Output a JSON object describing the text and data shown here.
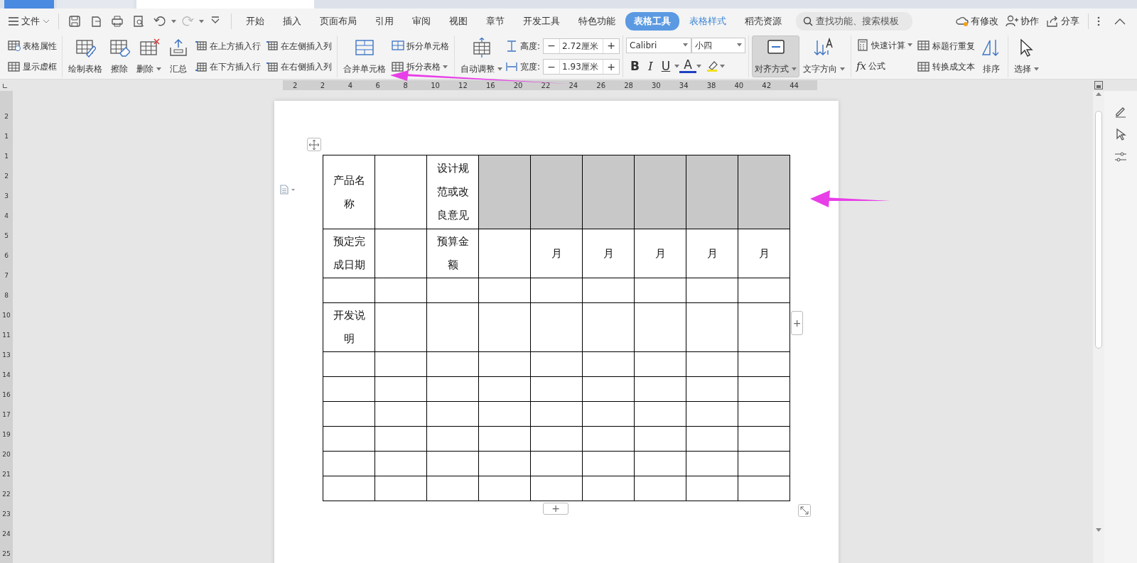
{
  "file_menu": {
    "label": "文件"
  },
  "menu_tabs": [
    {
      "label": "开始",
      "selected": false,
      "kind": "main"
    },
    {
      "label": "插入",
      "selected": false,
      "kind": "main"
    },
    {
      "label": "页面布局",
      "selected": false,
      "kind": "main"
    },
    {
      "label": "引用",
      "selected": false,
      "kind": "main"
    },
    {
      "label": "审阅",
      "selected": false,
      "kind": "main"
    },
    {
      "label": "视图",
      "selected": false,
      "kind": "main"
    },
    {
      "label": "章节",
      "selected": false,
      "kind": "main"
    },
    {
      "label": "开发工具",
      "selected": false,
      "kind": "main"
    },
    {
      "label": "特色功能",
      "selected": false,
      "kind": "main"
    },
    {
      "label": "表格工具",
      "selected": true,
      "kind": "context"
    },
    {
      "label": "表格样式",
      "selected": false,
      "kind": "context"
    },
    {
      "label": "稻壳资源",
      "selected": false,
      "kind": "main"
    }
  ],
  "search": {
    "placeholder": "查找功能、搜索模板"
  },
  "header_actions": [
    "有修改",
    "协作",
    "分享"
  ],
  "ribbon": {
    "groups": [
      {
        "items": [
          {
            "kind": "stack",
            "entries": [
              {
                "label": "表格属性"
              },
              {
                "label": "显示虚框"
              }
            ]
          }
        ]
      },
      {
        "items": [
          {
            "kind": "large",
            "label": "绘制表格",
            "pressed": false
          },
          {
            "kind": "large",
            "label": "擦除",
            "pressed": false
          },
          {
            "kind": "large",
            "label": "删除",
            "pressed": false,
            "dropdown": true
          },
          {
            "kind": "large",
            "label": "汇总",
            "pressed": false
          },
          {
            "kind": "stack",
            "entries": [
              {
                "label": "在上方插入行"
              },
              {
                "label": "在下方插入行"
              }
            ]
          },
          {
            "kind": "stack",
            "entries": [
              {
                "label": "在左侧插入列"
              },
              {
                "label": "在右侧插入列"
              }
            ]
          }
        ]
      },
      {
        "items": [
          {
            "kind": "large",
            "label": "合并单元格",
            "pressed": false
          },
          {
            "kind": "stack",
            "entries": [
              {
                "label": "拆分单元格"
              },
              {
                "label": "拆分表格",
                "dropdown": true
              }
            ]
          }
        ]
      },
      {
        "items": [
          {
            "kind": "large",
            "label": "自动调整",
            "pressed": false,
            "dropdown": true
          },
          {
            "kind": "spinners",
            "entries": [
              {
                "label": "高度:",
                "value": "2.72厘米",
                "decrement": "−",
                "increment": "+"
              },
              {
                "label": "宽度:",
                "value": "1.93厘米",
                "decrement": "−",
                "increment": "+"
              }
            ]
          }
        ]
      },
      {
        "items": [
          {
            "kind": "font",
            "font_name": "Calibri",
            "font_size": "小四",
            "bold": "B",
            "italic": "I",
            "underline": "U",
            "font_color": "A"
          }
        ]
      },
      {
        "items": [
          {
            "kind": "large",
            "label": "对齐方式",
            "pressed": true,
            "dropdown": true
          },
          {
            "kind": "large",
            "label": "文字方向",
            "pressed": false,
            "dropdown": true
          }
        ]
      },
      {
        "items": [
          {
            "kind": "stack",
            "entries": [
              {
                "label": "快速计算",
                "dropdown": true
              },
              {
                "label": "公式",
                "glyph": "fx"
              }
            ]
          },
          {
            "kind": "stack",
            "entries": [
              {
                "label": "标题行重复"
              },
              {
                "label": "转换成文本"
              }
            ]
          },
          {
            "kind": "large",
            "label": "排序",
            "pressed": false
          }
        ]
      },
      {
        "items": [
          {
            "kind": "large",
            "label": "选择",
            "pressed": false,
            "dropdown": true
          }
        ]
      }
    ]
  },
  "ruler": {
    "horizontal": [
      "2",
      "2",
      "4",
      "6",
      "8",
      "10",
      "12",
      "16",
      "20",
      "22",
      "24",
      "26",
      "28",
      "30",
      "34",
      "38",
      "40",
      "42",
      "44"
    ],
    "vertical": [
      "2",
      "1",
      "1",
      "2",
      "3",
      "4",
      "5",
      "6",
      "7",
      "8",
      "10",
      "11",
      "13",
      "14",
      "16",
      "17",
      "19",
      "20",
      "21",
      "22",
      "23",
      "24",
      "25"
    ]
  },
  "table": {
    "rows": [
      [
        {
          "text": "产品名称",
          "shaded": false
        },
        {
          "shaded": false
        },
        {
          "text": "设计规范或改良意见",
          "shaded": false
        },
        {
          "shaded": true
        },
        {
          "shaded": true
        },
        {
          "shaded": true
        },
        {
          "shaded": true
        },
        {
          "shaded": true
        },
        {
          "shaded": true
        }
      ],
      [
        {
          "text": "预定完成日期",
          "shaded": false
        },
        {
          "shaded": false
        },
        {
          "text": "预算金额",
          "shaded": false
        },
        {
          "shaded": false
        },
        {
          "text": "月",
          "shaded": false
        },
        {
          "text": "月",
          "shaded": false
        },
        {
          "text": "月",
          "shaded": false
        },
        {
          "text": "月",
          "shaded": false
        },
        {
          "text": "月",
          "shaded": false
        }
      ],
      [
        {
          "shaded": false
        },
        {
          "shaded": false
        },
        {
          "shaded": false
        },
        {
          "shaded": false
        },
        {
          "shaded": false
        },
        {
          "shaded": false
        },
        {
          "shaded": false
        },
        {
          "shaded": false
        },
        {
          "shaded": false
        }
      ],
      [
        {
          "text": "开发说明",
          "shaded": false
        },
        {
          "shaded": false
        },
        {
          "shaded": false
        },
        {
          "shaded": false
        },
        {
          "shaded": false
        },
        {
          "shaded": false
        },
        {
          "shaded": false
        },
        {
          "shaded": false
        },
        {
          "shaded": false
        }
      ],
      [
        {
          "shaded": false
        },
        {
          "shaded": false
        },
        {
          "shaded": false
        },
        {
          "shaded": false
        },
        {
          "shaded": false
        },
        {
          "shaded": false
        },
        {
          "shaded": false
        },
        {
          "shaded": false
        },
        {
          "shaded": false
        }
      ],
      [
        {
          "shaded": false
        },
        {
          "shaded": false
        },
        {
          "shaded": false
        },
        {
          "shaded": false
        },
        {
          "shaded": false
        },
        {
          "shaded": false
        },
        {
          "shaded": false
        },
        {
          "shaded": false
        },
        {
          "shaded": false
        }
      ],
      [
        {
          "shaded": false
        },
        {
          "shaded": false
        },
        {
          "shaded": false
        },
        {
          "shaded": false
        },
        {
          "shaded": false
        },
        {
          "shaded": false
        },
        {
          "shaded": false
        },
        {
          "shaded": false
        },
        {
          "shaded": false
        }
      ],
      [
        {
          "shaded": false
        },
        {
          "shaded": false
        },
        {
          "shaded": false
        },
        {
          "shaded": false
        },
        {
          "shaded": false
        },
        {
          "shaded": false
        },
        {
          "shaded": false
        },
        {
          "shaded": false
        },
        {
          "shaded": false
        }
      ],
      [
        {
          "shaded": false
        },
        {
          "shaded": false
        },
        {
          "shaded": false
        },
        {
          "shaded": false
        },
        {
          "shaded": false
        },
        {
          "shaded": false
        },
        {
          "shaded": false
        },
        {
          "shaded": false
        },
        {
          "shaded": false
        }
      ],
      [
        {
          "shaded": false
        },
        {
          "shaded": false
        },
        {
          "shaded": false
        },
        {
          "shaded": false
        },
        {
          "shaded": false
        },
        {
          "shaded": false
        },
        {
          "shaded": false
        },
        {
          "shaded": false
        },
        {
          "shaded": false
        }
      ]
    ],
    "add_column": "+",
    "add_row": "+"
  }
}
